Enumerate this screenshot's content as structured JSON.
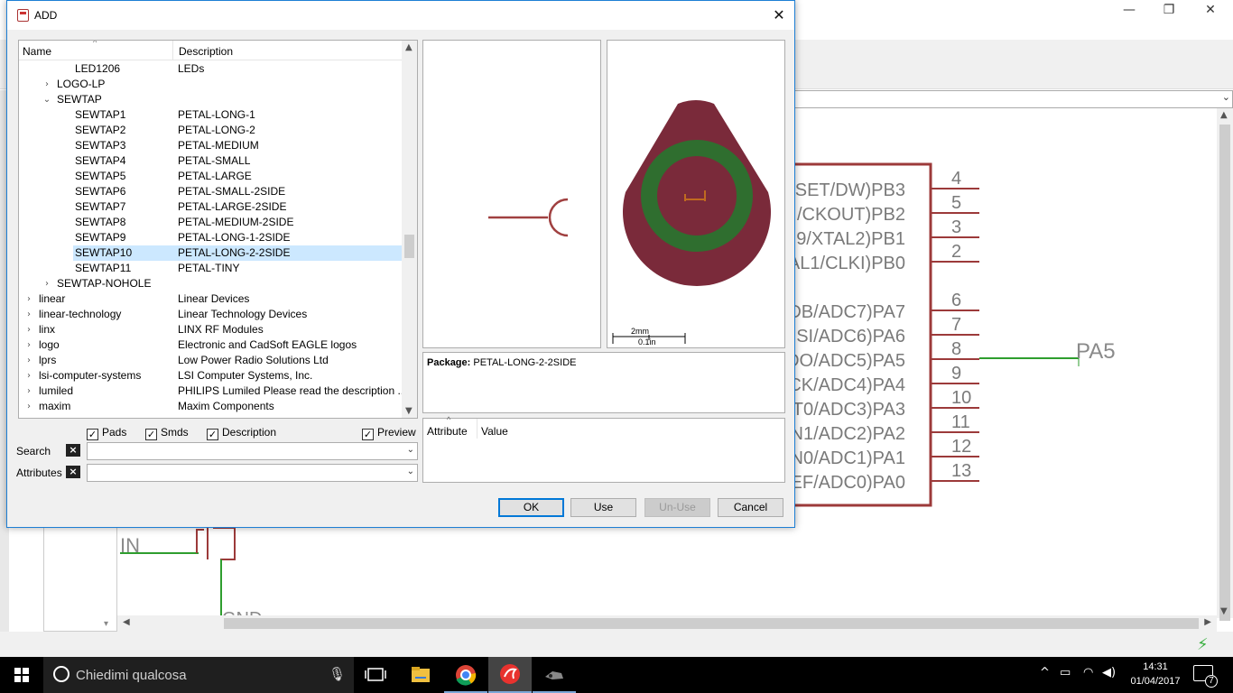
{
  "dialog": {
    "title": "ADD",
    "tree": {
      "columns": [
        "Name",
        "Description"
      ],
      "rows": [
        {
          "name": "LED1206",
          "desc": "LEDs",
          "level": 2,
          "expander": ""
        },
        {
          "name": "LOGO-LP",
          "desc": "",
          "level": 1,
          "expander": ">"
        },
        {
          "name": "SEWTAP",
          "desc": "",
          "level": 1,
          "expander": "v"
        },
        {
          "name": "SEWTAP1",
          "desc": "PETAL-LONG-1",
          "level": 2,
          "expander": ""
        },
        {
          "name": "SEWTAP2",
          "desc": "PETAL-LONG-2",
          "level": 2,
          "expander": ""
        },
        {
          "name": "SEWTAP3",
          "desc": "PETAL-MEDIUM",
          "level": 2,
          "expander": ""
        },
        {
          "name": "SEWTAP4",
          "desc": "PETAL-SMALL",
          "level": 2,
          "expander": ""
        },
        {
          "name": "SEWTAP5",
          "desc": "PETAL-LARGE",
          "level": 2,
          "expander": ""
        },
        {
          "name": "SEWTAP6",
          "desc": "PETAL-SMALL-2SIDE",
          "level": 2,
          "expander": ""
        },
        {
          "name": "SEWTAP7",
          "desc": "PETAL-LARGE-2SIDE",
          "level": 2,
          "expander": ""
        },
        {
          "name": "SEWTAP8",
          "desc": "PETAL-MEDIUM-2SIDE",
          "level": 2,
          "expander": ""
        },
        {
          "name": "SEWTAP9",
          "desc": "PETAL-LONG-1-2SIDE",
          "level": 2,
          "expander": ""
        },
        {
          "name": "SEWTAP10",
          "desc": "PETAL-LONG-2-2SIDE",
          "level": 2,
          "expander": "",
          "selected": true
        },
        {
          "name": "SEWTAP11",
          "desc": "PETAL-TINY",
          "level": 2,
          "expander": ""
        },
        {
          "name": "SEWTAP-NOHOLE",
          "desc": "",
          "level": 1,
          "expander": ">"
        },
        {
          "name": "linear",
          "desc": "Linear Devices",
          "level": 0,
          "expander": ">"
        },
        {
          "name": "linear-technology",
          "desc": "Linear Technology Devices",
          "level": 0,
          "expander": ">"
        },
        {
          "name": "linx",
          "desc": "LINX RF Modules",
          "level": 0,
          "expander": ">"
        },
        {
          "name": "logo",
          "desc": "Electronic and CadSoft EAGLE logos",
          "level": 0,
          "expander": ">"
        },
        {
          "name": "lprs",
          "desc": "Low Power Radio Solutions Ltd",
          "level": 0,
          "expander": ">"
        },
        {
          "name": "lsi-computer-systems",
          "desc": "LSI Computer Systems, Inc.",
          "level": 0,
          "expander": ">"
        },
        {
          "name": "lumiled",
          "desc": "PHILIPS Lumiled Please read the description ...",
          "level": 0,
          "expander": ">"
        },
        {
          "name": "maxim",
          "desc": "Maxim Components",
          "level": 0,
          "expander": ">"
        }
      ]
    },
    "checkboxes": {
      "pads": "Pads",
      "smds": "Smds",
      "description": "Description",
      "preview": "Preview",
      "check_mark": "✓"
    },
    "search_label": "Search",
    "attributes_label": "Attributes",
    "clear_glyph": "×",
    "combo_arrow": "⌄",
    "package_label": "Package:",
    "package_value": "PETAL-LONG-2-2SIDE",
    "scale": {
      "top": "2mm",
      "bottom": "0.1in"
    },
    "attr_columns": {
      "attribute": "Attribute",
      "value": "Value"
    },
    "buttons": {
      "ok": "OK",
      "use": "Use",
      "unuse": "Un-Use",
      "cancel": "Cancel"
    },
    "close_glyph": "✕"
  },
  "background": {
    "win_controls": {
      "min": "—",
      "restore": "❐",
      "close": "✕"
    },
    "pin_labels": [
      "SET/DW)PB3",
      "/CKOUT)PB2",
      "9/XTAL2)PB1",
      "AL1/CLKI)PB0",
      "DB/ADC7)PA7",
      "SI/ADC6)PA6",
      "DO/ADC5)PA5",
      "CK/ADC4)PA4",
      "T0/ADC3)PA3",
      "N1/ADC2)PA2",
      "N0/ADC1)PA1",
      "EF/ADC0)PA0"
    ],
    "pin_numbers": [
      "4",
      "5",
      "3",
      "2",
      "6",
      "7",
      "8",
      "9",
      "10",
      "11",
      "12",
      "13"
    ],
    "net_label": "PA5",
    "in_label": "IN",
    "gnd_label": "GND"
  },
  "taskbar": {
    "search_placeholder": "Chiedimi qualcosa",
    "time": "14:31",
    "date": "01/04/2017",
    "notifications": "7"
  },
  "colors": {
    "accent": "#0078d7",
    "selection": "#cce8ff",
    "schematic_red": "#9c3a3a",
    "wire_green": "#2e9e2e",
    "pad_maroon": "#7a2a3a",
    "pad_green": "#2f6e2f"
  }
}
